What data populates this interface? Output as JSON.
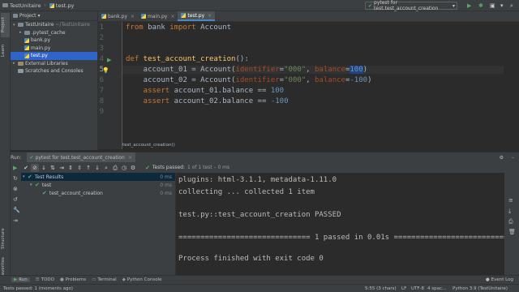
{
  "navbar": {
    "project": "TestUnitaire",
    "file": "test.py",
    "run_config": "pytest for test.test_account_creation"
  },
  "left_strip": {
    "project_tab": "Project",
    "learn_tab": "Learn",
    "structure_tab": "Structure",
    "favorites_tab": "Favorites"
  },
  "project_panel": {
    "header": "Project",
    "tree": [
      {
        "label": "TestUnitaire",
        "path": "~/TestUnitaire",
        "depth": 0,
        "kind": "folder",
        "open": true
      },
      {
        "label": ".pytest_cache",
        "depth": 1,
        "kind": "folder",
        "open": false
      },
      {
        "label": "bank.py",
        "depth": 1,
        "kind": "py"
      },
      {
        "label": "main.py",
        "depth": 1,
        "kind": "py"
      },
      {
        "label": "test.py",
        "depth": 1,
        "kind": "py",
        "selected": true
      },
      {
        "label": "External Libraries",
        "depth": 0,
        "kind": "lib",
        "open": false
      },
      {
        "label": "Scratches and Consoles",
        "depth": 0,
        "kind": "scratch"
      }
    ]
  },
  "editor": {
    "tabs": [
      {
        "label": "bank.py",
        "active": false
      },
      {
        "label": "main.py",
        "active": false
      },
      {
        "label": "test.py",
        "active": true
      }
    ],
    "line_numbers": [
      "1",
      "2",
      "3",
      "4",
      "5",
      "6",
      "7",
      "8",
      "9"
    ],
    "lines": {
      "l1_from": "from",
      "l1_mod": " bank ",
      "l1_import": "import",
      "l1_name": " Account",
      "l4_def": "def",
      "l4_fn": " test_account_creation",
      "l4_rest": "():",
      "l5_a": "    account_01 = Account(",
      "l5_p1": "identifier",
      "l5_eq1": "=",
      "l5_s1": "\"000\"",
      "l5_c": ", ",
      "l5_p2": "balance",
      "l5_eq2": "=",
      "l5_n": "100",
      "l5_end": ")",
      "l6_a": "    account_02 = Account(",
      "l6_p1": "identifier",
      "l6_eq1": "=",
      "l6_s1": "\"000\"",
      "l6_c": ", ",
      "l6_p2": "balance",
      "l6_eq2": "=",
      "l6_n": "-100",
      "l6_end": ")",
      "l7_kw": "    assert",
      "l7_rest": " account_01.balance == ",
      "l7_n": "100",
      "l8_kw": "    assert",
      "l8_rest": " account_02.balance == ",
      "l8_n": "-100"
    },
    "breadcrumb": "test_account_creation()"
  },
  "run": {
    "label": "Run:",
    "tab": "pytest for test.test_account_creation",
    "status_prefix": "Tests passed:",
    "status_rest": "1 of 1 test – 0 ms",
    "tree": [
      {
        "label": "Test Results",
        "depth": 0,
        "duration": "0 ms",
        "selected": true
      },
      {
        "label": "test",
        "depth": 1,
        "duration": "0 ms"
      },
      {
        "label": "test_account_creation",
        "depth": 2,
        "duration": "0 ms"
      }
    ],
    "console": [
      "plugins: html-3.1.1, metadata-1.11.0",
      "collecting ... collected 1 item",
      "",
      "test.py::test_account_creation PASSED",
      "",
      "============================== 1 passed in 0.01s ===============================",
      "",
      "Process finished with exit code 0"
    ]
  },
  "bottom_tabs": [
    "Run",
    "TODO",
    "Problems",
    "Terminal",
    "Python Console"
  ],
  "event_log": "Event Log",
  "statusbar": {
    "message": "Tests passed: 1 (moments ago)",
    "position": "5:55 (3 chars)",
    "line_ending": "LF",
    "encoding": "UTF-8",
    "indent": "4 spac...",
    "interpreter": "Python 3.9 (TestUnitaire)"
  }
}
